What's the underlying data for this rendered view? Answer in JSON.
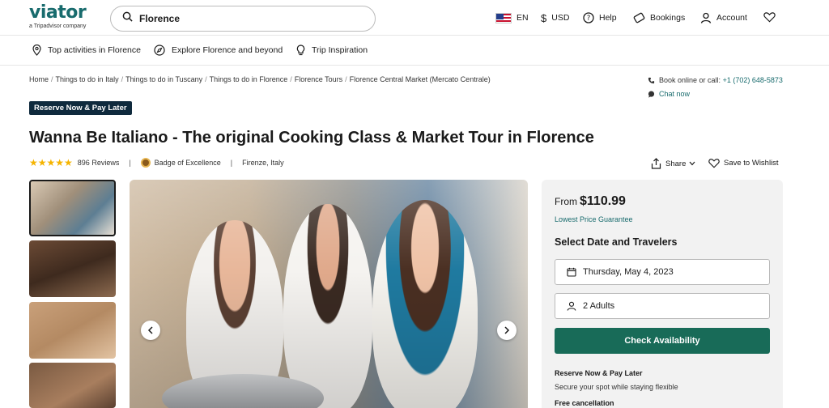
{
  "header": {
    "logo": "viator",
    "logo_sub": "a Tripadvisor company",
    "search_value": "Florence",
    "language": "EN",
    "currency": "USD",
    "help": "Help",
    "bookings": "Bookings",
    "account": "Account"
  },
  "subnav": {
    "items": [
      "Top activities in Florence",
      "Explore Florence and beyond",
      "Trip Inspiration"
    ]
  },
  "breadcrumb": [
    "Home",
    "Things to do in Italy",
    "Things to do in Tuscany",
    "Things to do in Florence",
    "Florence Tours",
    "Florence Central Market (Mercato Centrale)"
  ],
  "contact": {
    "label": "Book online or call:",
    "phone": "+1 (702) 648-5873",
    "chat": "Chat now"
  },
  "product": {
    "badge": "Reserve Now & Pay Later",
    "title": "Wanna Be Italiano - The original Cooking Class & Market Tour in Florence",
    "rating": 5,
    "stars": "★★★★★",
    "reviews": "896 Reviews",
    "excellence": "Badge of Excellence",
    "location": "Firenze, Italy",
    "share": "Share",
    "wishlist": "Save to Wishlist"
  },
  "booking": {
    "from": "From",
    "price": "$110.99",
    "lowest": "Lowest Price Guarantee",
    "select_title": "Select Date and Travelers",
    "date": "Thursday, May 4, 2023",
    "travelers": "2 Adults",
    "check": "Check Availability",
    "reserve_title": "Reserve Now & Pay Later",
    "reserve_sub": "Secure your spot while staying flexible",
    "free_cancel": "Free cancellation"
  },
  "colors": {
    "brand": "#186b6d",
    "button": "#186b58",
    "star": "#f5b400"
  }
}
